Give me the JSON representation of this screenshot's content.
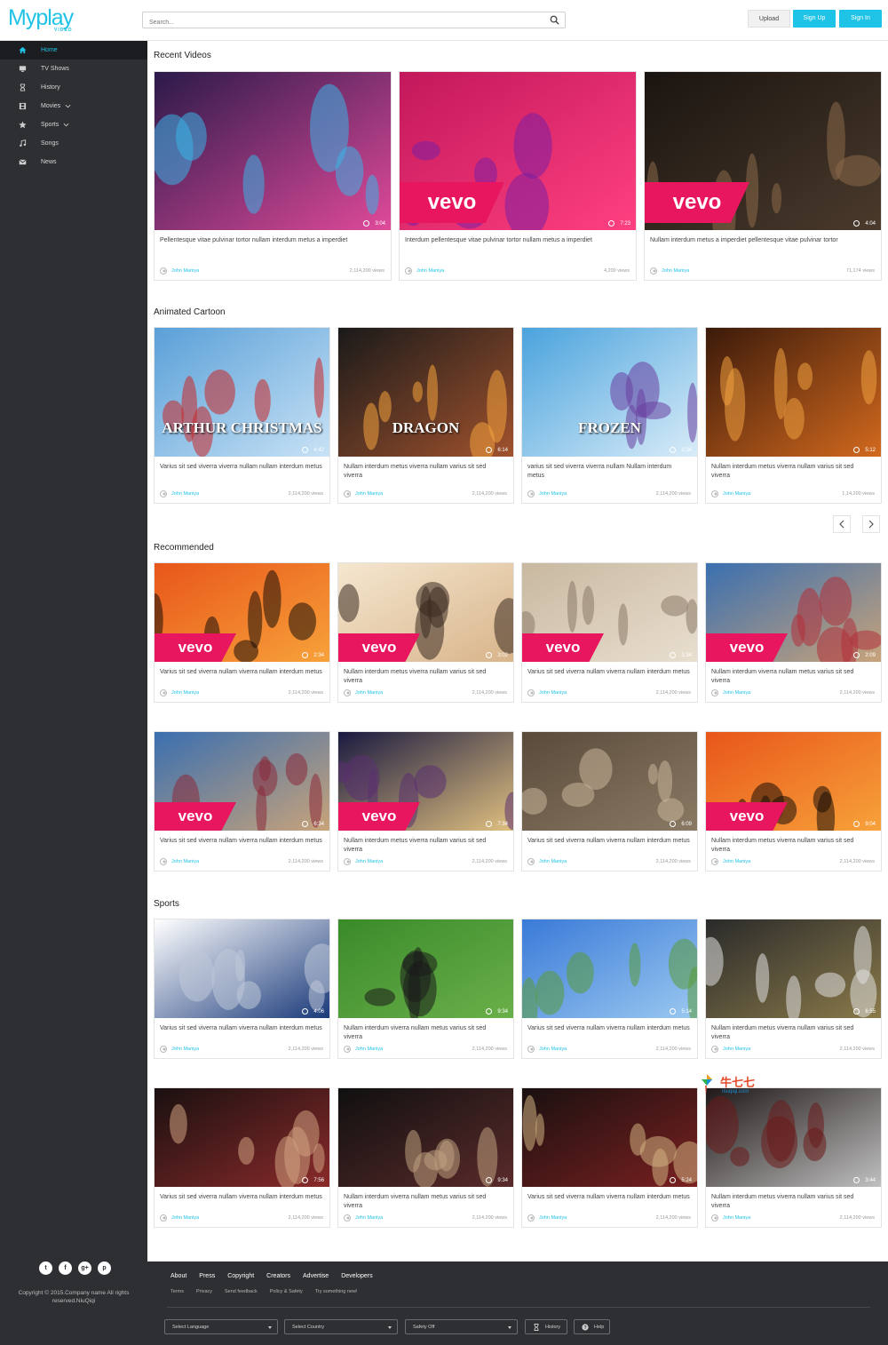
{
  "header": {
    "logo_main": "Myplay",
    "logo_sub": "VIDEO",
    "search_placeholder": "Search...",
    "upload_label": "Upload",
    "signup_label": "Sign Up",
    "signin_label": "Sign In"
  },
  "sidebar": {
    "items": [
      {
        "label": "Home",
        "icon": "home-icon",
        "active": true
      },
      {
        "label": "TV Shows",
        "icon": "tv-icon"
      },
      {
        "label": "History",
        "icon": "hourglass-icon"
      },
      {
        "label": "Movies",
        "icon": "film-icon",
        "dropdown": true
      },
      {
        "label": "Sports",
        "icon": "star-icon",
        "dropdown": true
      },
      {
        "label": "Songs",
        "icon": "music-icon"
      },
      {
        "label": "News",
        "icon": "envelope-icon"
      }
    ],
    "social": [
      "twitter-icon",
      "facebook-icon",
      "google-plus-icon",
      "pinterest-icon"
    ],
    "social_glyphs": [
      "t",
      "f",
      "g+",
      "p"
    ],
    "copyright": "Copyright © 2015.Company name All rights reserved.NiuQiqi"
  },
  "sections": {
    "recent": "Recent Videos",
    "cartoon": "Animated Cartoon",
    "recommended": "Recommended",
    "sports": "Sports"
  },
  "recent_videos": [
    {
      "title": "Pellentesque vitae pulvinar tortor nullam interdum metus a imperdiet",
      "author": "John Maniya",
      "views": "2,114,200 views",
      "duration": "3:04"
    },
    {
      "title": "Interdum pellentesque vitae pulvinar tortor nullam metus a imperdiet",
      "author": "John Maniya",
      "views": "4,200 views",
      "duration": "7:23"
    },
    {
      "title": "Nullam interdum metus a imperdiet pellentesque vitae pulvinar tortor",
      "author": "John Maniya",
      "views": "71,174 views",
      "duration": "4:04"
    }
  ],
  "cartoon_videos": [
    {
      "title": "Varius sit sed viverra viverra nullam nullam interdum metus",
      "author": "John Maniya",
      "views": "2,114,200 views",
      "duration": "4:42",
      "overlay": "ARTHUR CHRISTMAS"
    },
    {
      "title": "Nullam interdum metus viverra nullam varius sit sed viverra",
      "author": "John Maniya",
      "views": "2,114,200 views",
      "duration": "6:14",
      "overlay": "DRAGON"
    },
    {
      "title": "varius sit sed viverra viverra nullam Nullam interdum metus",
      "author": "John Maniya",
      "views": "2,114,200 views",
      "duration": "2:34",
      "overlay": "FROZEN"
    },
    {
      "title": "Nullam interdum metus viverra nullam varius sit sed viverra",
      "author": "John Maniya",
      "views": "1,14,200 views",
      "duration": "5:12",
      "overlay": ""
    }
  ],
  "recommended_videos": [
    {
      "title": "Varius sit sed viverra nullam viverra nullam interdum metus",
      "author": "John Maniya",
      "views": "2,114,200 views",
      "duration": "2:34"
    },
    {
      "title": "Nullam interdum metus viverra nullam varius sit sed viverra",
      "author": "John Maniya",
      "views": "2,114,200 views",
      "duration": "3:02"
    },
    {
      "title": "Varius sit sed viverra nullam viverra nullam interdum metus",
      "author": "John Maniya",
      "views": "2,114,200 views",
      "duration": "1:34"
    },
    {
      "title": "Nullam interdum viverra nullam metus varius sit sed viverra",
      "author": "John Maniya",
      "views": "2,114,200 views",
      "duration": "2:09"
    },
    {
      "title": "Varius sit sed viverra nullam viverra nullam interdum metus",
      "author": "John Maniya",
      "views": "2,114,200 views",
      "duration": "6:34"
    },
    {
      "title": "Nullam interdum metus viverra nullam varius sit sed viverra",
      "author": "John Maniya",
      "views": "2,114,200 views",
      "duration": "7:34"
    },
    {
      "title": "Varius sit sed viverra nullam viverra nullam interdum metus",
      "author": "John Maniya",
      "views": "2,114,200 views",
      "duration": "6:09"
    },
    {
      "title": "Nullam interdum metus viverra nullam varius sit sed viverra",
      "author": "John Maniya",
      "views": "2,114,200 views",
      "duration": "9:04"
    }
  ],
  "sports_videos": [
    {
      "title": "Varius sit sed viverra nullam viverra nullam interdum metus",
      "author": "John Maniya",
      "views": "2,114,200 views",
      "duration": "4:06"
    },
    {
      "title": "Nullam interdum viverra nullam metus varius sit sed viverra",
      "author": "John Maniya",
      "views": "2,114,200 views",
      "duration": "9:34"
    },
    {
      "title": "Varius sit sed viverra nullam viverra nullam interdum metus",
      "author": "John Maniya",
      "views": "2,114,200 views",
      "duration": "5:14"
    },
    {
      "title": "Nullam interdum metus viverra nullam varius sit sed viverra",
      "author": "John Maniya",
      "views": "2,114,200 views",
      "duration": "6:55"
    },
    {
      "title": "Varius sit sed viverra nullam viverra nullam interdum metus",
      "author": "John Maniya",
      "views": "2,114,200 views",
      "duration": "7:56"
    },
    {
      "title": "Nullam interdum viverra nullam metus varius sit sed viverra",
      "author": "John Maniya",
      "views": "2,114,200 views",
      "duration": "9:34"
    },
    {
      "title": "Varius sit sed viverra nullam viverra nullam interdum metus",
      "author": "John Maniya",
      "views": "2,114,200 views",
      "duration": "5:24"
    },
    {
      "title": "Nullam interdum metus viverra nullam varius sit sed viverra",
      "author": "John Maniya",
      "views": "2,114,200 views",
      "duration": "3:44"
    }
  ],
  "vevo_label": "vevo",
  "footer": {
    "links": [
      "About",
      "Press",
      "Copyright",
      "Creators",
      "Advertise",
      "Developers"
    ],
    "sublinks": [
      "Terms",
      "Privacy",
      "Send feedback",
      "Policy & Safety",
      "Try something new!"
    ],
    "select_language": "Select Language",
    "select_country": "Select Country",
    "safety": "Safety Off",
    "history_btn": "History",
    "help_btn": "Help"
  },
  "watermark": {
    "cn": "牛七七",
    "site": "niuqiqi.com"
  },
  "colors": {
    "accent": "#1fc3e5",
    "sidebar": "#2d2f33",
    "vevo": "#e8155f"
  }
}
